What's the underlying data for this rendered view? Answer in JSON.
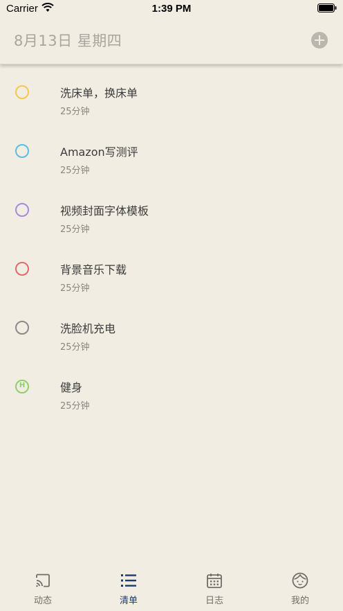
{
  "status_bar": {
    "carrier": "Carrier",
    "time": "1:39 PM"
  },
  "header": {
    "title": "8月13日 星期四",
    "add_icon": "plus-circle-icon"
  },
  "tasks": [
    {
      "title": "洗床单，换床单",
      "duration": "25分钟",
      "color": "#f5c84a",
      "icon": "circle"
    },
    {
      "title": "Amazon写测评",
      "duration": "25分钟",
      "color": "#5bbde3",
      "icon": "circle"
    },
    {
      "title": "视频封面字体模板",
      "duration": "25分钟",
      "color": "#a58ae0",
      "icon": "circle"
    },
    {
      "title": "背景音乐下载",
      "duration": "25分钟",
      "color": "#e06a6a",
      "icon": "circle"
    },
    {
      "title": "洗脸机充电",
      "duration": "25分钟",
      "color": "#8a8a8a",
      "icon": "circle"
    },
    {
      "title": "健身",
      "duration": "25分钟",
      "color": "#8fcf6a",
      "icon": "circle-h"
    }
  ],
  "tabbar": {
    "active": "清单",
    "accent_color": "#1e3a6b",
    "tabs": [
      {
        "label": "动态",
        "icon": "cast-icon"
      },
      {
        "label": "清单",
        "icon": "list-icon"
      },
      {
        "label": "日志",
        "icon": "calendar-icon"
      },
      {
        "label": "我的",
        "icon": "face-icon"
      }
    ]
  }
}
